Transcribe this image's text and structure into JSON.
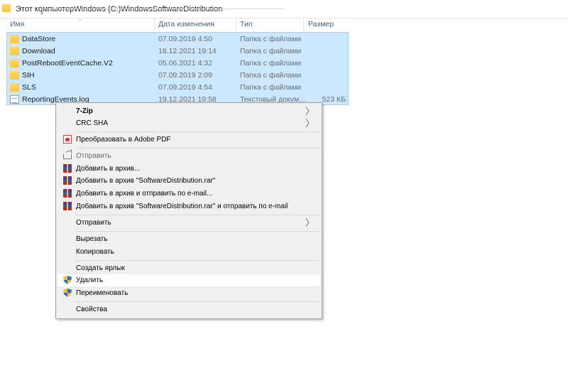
{
  "address_bar": {
    "crumbs": [
      "Этот компьютер",
      "Windows (C:)",
      "Windows",
      "SoftwareDistribution"
    ],
    "separator": "›"
  },
  "columns": {
    "name": "Имя",
    "date": "Дата изменения",
    "type": "Тип",
    "size": "Размер"
  },
  "files": [
    {
      "name": "DataStore",
      "date": "07.09.2019 4:50",
      "type": "Папка с файлами",
      "size": "",
      "icon": "folder-icon"
    },
    {
      "name": "Download",
      "date": "18.12.2021 19:14",
      "type": "Папка с файлами",
      "size": "",
      "icon": "folder-icon"
    },
    {
      "name": "PostRebootEventCache.V2",
      "date": "05.06.2021 4:32",
      "type": "Папка с файлами",
      "size": "",
      "icon": "folder-icon"
    },
    {
      "name": "SIH",
      "date": "07.09.2019 2:09",
      "type": "Папка с файлами",
      "size": "",
      "icon": "folder-icon"
    },
    {
      "name": "SLS",
      "date": "07.09.2019 4:54",
      "type": "Папка с файлами",
      "size": "",
      "icon": "folder-icon"
    },
    {
      "name": "ReportingEvents.log",
      "date": "19.12.2021 19:58",
      "type": "Текстовый докум...",
      "size": "523 КБ",
      "icon": "text-document-icon"
    }
  ],
  "context_menu": {
    "items": [
      {
        "label": "7-Zip",
        "submenu": true
      },
      {
        "label": "CRC SHA",
        "submenu": true
      },
      {
        "label": "Преобразовать в Adobe PDF",
        "icon": "adobe-pdf-icon"
      },
      {
        "label": "Отправить",
        "icon": "share-icon",
        "disabled": true
      },
      {
        "label": "Добавить в архив...",
        "icon": "winrar-icon"
      },
      {
        "label": "Добавить в архив \"SoftwareDistribution.rar\"",
        "icon": "winrar-icon"
      },
      {
        "label": "Добавить в архив и отправить по e-mail...",
        "icon": "winrar-icon"
      },
      {
        "label": "Добавить в архив \"SoftwareDistribution.rar\" и отправить по e-mail",
        "icon": "winrar-icon"
      },
      {
        "label": "Отправить",
        "submenu": true
      },
      {
        "label": "Вырезать"
      },
      {
        "label": "Копировать"
      },
      {
        "label": "Создать ярлык"
      },
      {
        "label": "Удалить",
        "icon": "uac-shield-icon",
        "hovered": true
      },
      {
        "label": "Переименовать",
        "icon": "uac-shield-icon"
      },
      {
        "label": "Свойства"
      }
    ],
    "submenu_arrow": "〉"
  },
  "colors": {
    "selection_bg": "#cce8ff",
    "selection_border": "#99d1ff",
    "menu_bg": "#f0f0f0",
    "folder": "#f8c845"
  }
}
